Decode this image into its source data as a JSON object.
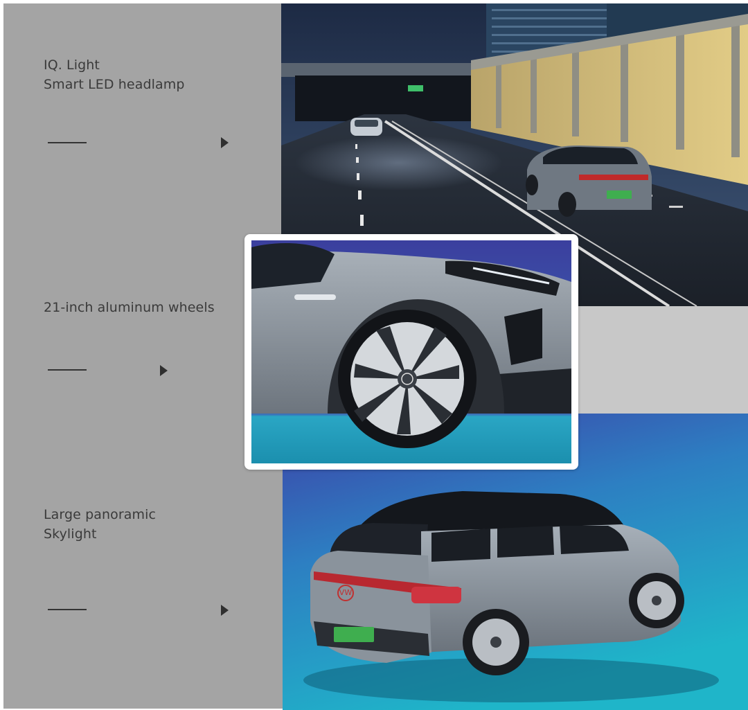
{
  "features": [
    {
      "id": "headlamp",
      "lines": [
        "IQ. Light",
        "Smart LED headlamp"
      ],
      "icons": {
        "line": "dash-line-icon",
        "arrow": "play-arrow-icon"
      }
    },
    {
      "id": "wheels",
      "lines": [
        "21-inch aluminum wheels"
      ],
      "icons": {
        "line": "dash-line-icon",
        "arrow": "play-arrow-icon"
      }
    },
    {
      "id": "skylight",
      "lines": [
        "Large panoramic",
        "Skylight"
      ],
      "icons": {
        "line": "dash-line-icon",
        "arrow": "play-arrow-icon"
      }
    }
  ],
  "colors": {
    "panel": "#a4a4a4",
    "text": "#3a3a3a",
    "accent_blue": "#3b3f9e",
    "accent_teal": "#2aa6c4",
    "car_grey": "#7d8690"
  }
}
